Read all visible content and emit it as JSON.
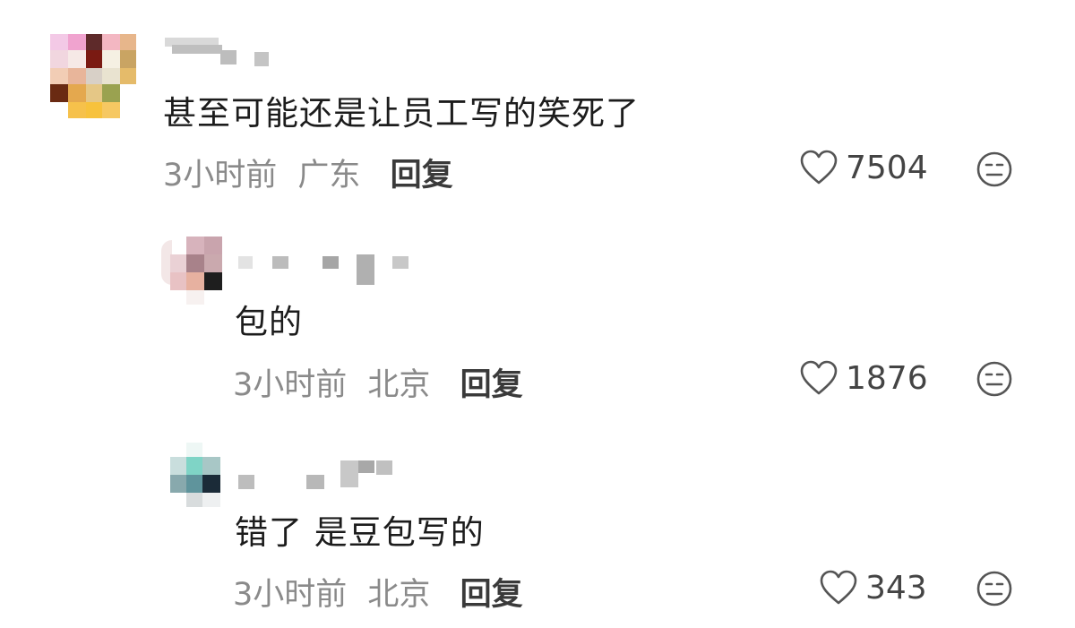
{
  "comments": [
    {
      "text": "甚至可能还是让员工写的笑死了",
      "time": "3小时前",
      "location": "广东",
      "reply_label": "回复",
      "likes": "7504"
    },
    {
      "text": "包的",
      "time": "3小时前",
      "location": "北京",
      "reply_label": "回复",
      "likes": "1876"
    },
    {
      "text": "错了 是豆包写的",
      "time": "3小时前",
      "location": "北京",
      "reply_label": "回复",
      "likes": "343"
    }
  ],
  "icons": {
    "like": "heart-outline-icon",
    "reaction": "neutral-face-icon"
  }
}
